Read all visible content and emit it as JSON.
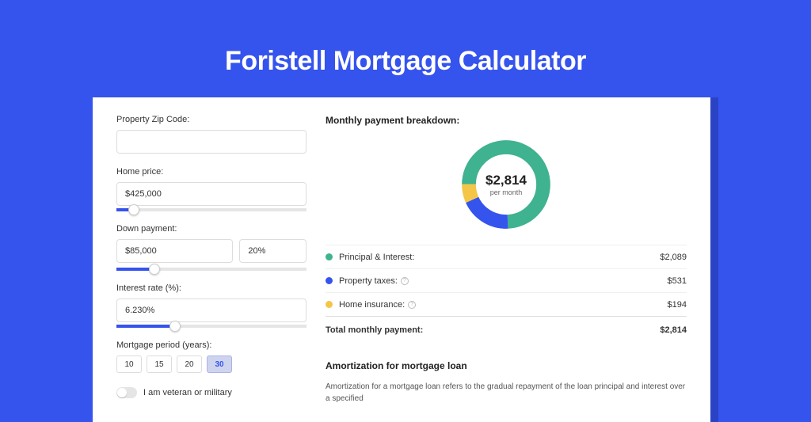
{
  "title": "Foristell Mortgage Calculator",
  "form": {
    "zip_label": "Property Zip Code:",
    "zip_value": "",
    "price_label": "Home price:",
    "price_value": "$425,000",
    "down_label": "Down payment:",
    "down_value": "$85,000",
    "down_pct": "20%",
    "rate_label": "Interest rate (%):",
    "rate_value": "6.230%",
    "period_label": "Mortgage period (years):",
    "periods": [
      "10",
      "15",
      "20",
      "30"
    ],
    "period_selected": "30",
    "military_label": "I am veteran or military"
  },
  "breakdown": {
    "heading": "Monthly payment breakdown:",
    "total_amt": "$2,814",
    "per_month": "per month",
    "legend": {
      "pi_label": "Principal & Interest:",
      "pi_value": "$2,089",
      "tax_label": "Property taxes:",
      "tax_value": "$531",
      "ins_label": "Home insurance:",
      "ins_value": "$194",
      "total_label": "Total monthly payment:",
      "total_value": "$2,814"
    }
  },
  "amort": {
    "heading": "Amortization for mortgage loan",
    "text": "Amortization for a mortgage loan refers to the gradual repayment of the loan principal and interest over a specified"
  },
  "colors": {
    "green": "#3fb28f",
    "blue": "#3553ed",
    "yellow": "#f4c648"
  },
  "chart_data": {
    "type": "pie",
    "title": "Monthly payment breakdown",
    "series": [
      {
        "name": "Principal & Interest",
        "value": 2089,
        "color": "#3fb28f"
      },
      {
        "name": "Property taxes",
        "value": 531,
        "color": "#3553ed"
      },
      {
        "name": "Home insurance",
        "value": 194,
        "color": "#f4c648"
      }
    ],
    "total": 2814,
    "center_label": "$2,814",
    "center_sub": "per month"
  }
}
